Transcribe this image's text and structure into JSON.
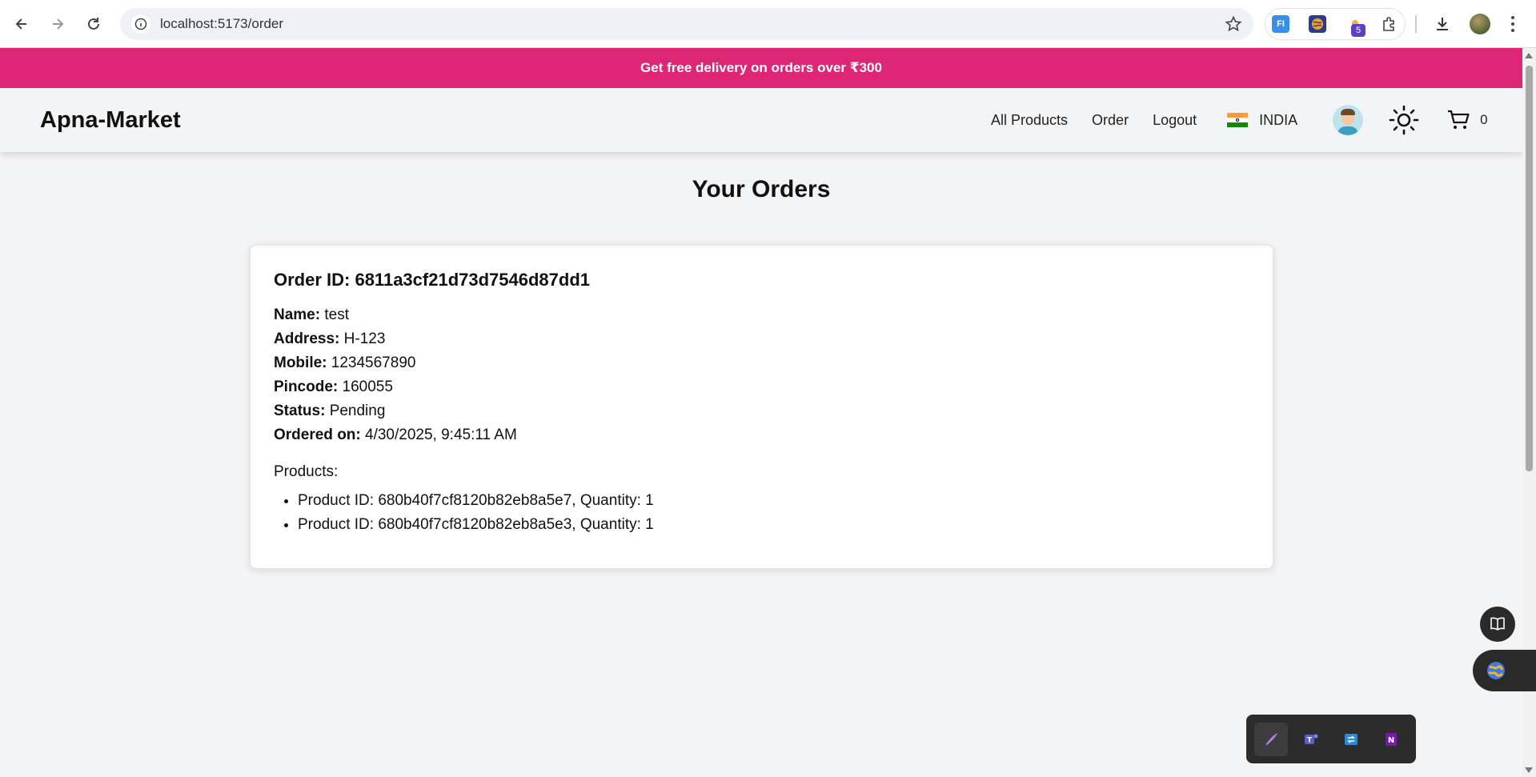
{
  "browser": {
    "url": "localhost:5173/order",
    "extension_badge": "5"
  },
  "promo": {
    "text": "Get free delivery on orders over ₹300"
  },
  "header": {
    "logo": "Apna-Market",
    "nav": [
      "All Products",
      "Order",
      "Logout"
    ],
    "country": "INDIA",
    "cart_count": "0"
  },
  "page": {
    "title": "Your Orders"
  },
  "order": {
    "id_label": "Order ID: 6811a3cf21d73d7546d87dd1",
    "fields": [
      {
        "label": "Name:",
        "value": "test"
      },
      {
        "label": "Address:",
        "value": "H-123"
      },
      {
        "label": "Mobile:",
        "value": "1234567890"
      },
      {
        "label": "Pincode:",
        "value": "160055"
      },
      {
        "label": "Status:",
        "value": "Pending"
      },
      {
        "label": "Ordered on:",
        "value": "4/30/2025, 9:45:11 AM"
      }
    ],
    "products_label": "Products:",
    "products": [
      "Product ID: 680b40f7cf8120b82eb8a5e7, Quantity: 1",
      "Product ID: 680b40f7cf8120b82eb8a5e3, Quantity: 1"
    ]
  },
  "colors": {
    "promo_bg": "#de2677",
    "page_bg": "#f3f4f6",
    "card_bg": "#ffffff"
  }
}
